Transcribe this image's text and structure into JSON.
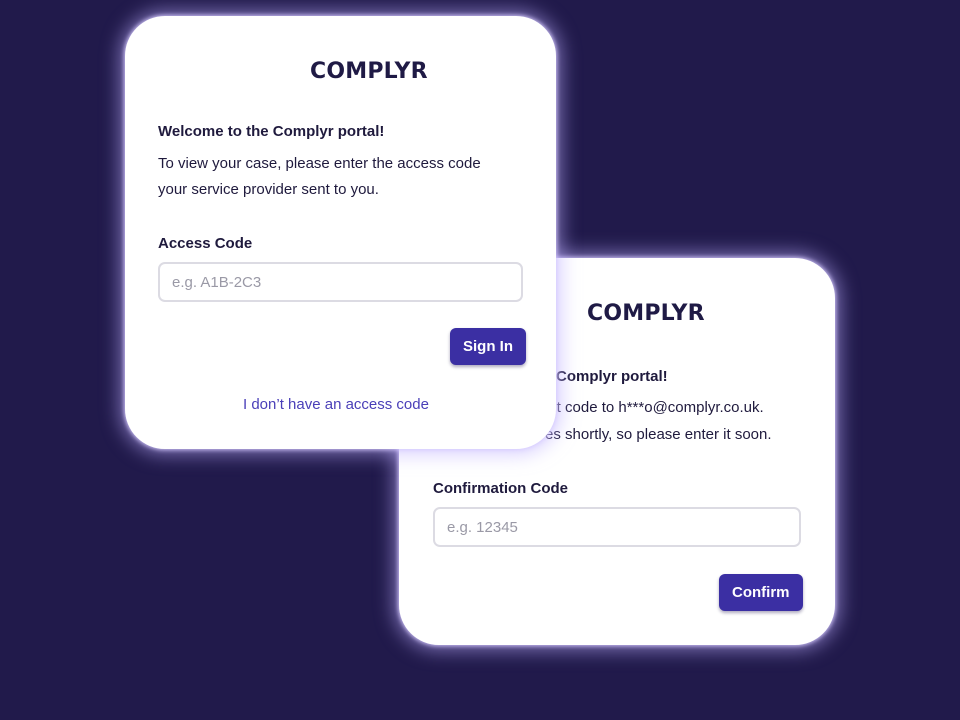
{
  "brand": {
    "name": "COMPLYR",
    "accent_color": "#3b2fa3",
    "logo_color": "#d46ee0",
    "background_color": "#211a4b"
  },
  "signin_card": {
    "heading": "Welcome to the Complyr portal!",
    "description_line1": "To view your case, please enter the access code",
    "description_line2": "your service provider sent to you.",
    "field_label": "Access Code",
    "field_placeholder": "e.g. A1B-2C3",
    "button_label": "Sign In",
    "link_label": "I don’t have an access code"
  },
  "confirm_card": {
    "heading_visible": "Complyr portal!",
    "description_line1_visible": "git code to h***o@complyr.co.uk.",
    "description_line2_visible": "es shortly, so please enter it soon.",
    "field_label": "Confirmation Code",
    "field_placeholder": "e.g. 12345",
    "button_label": "Confirm"
  }
}
